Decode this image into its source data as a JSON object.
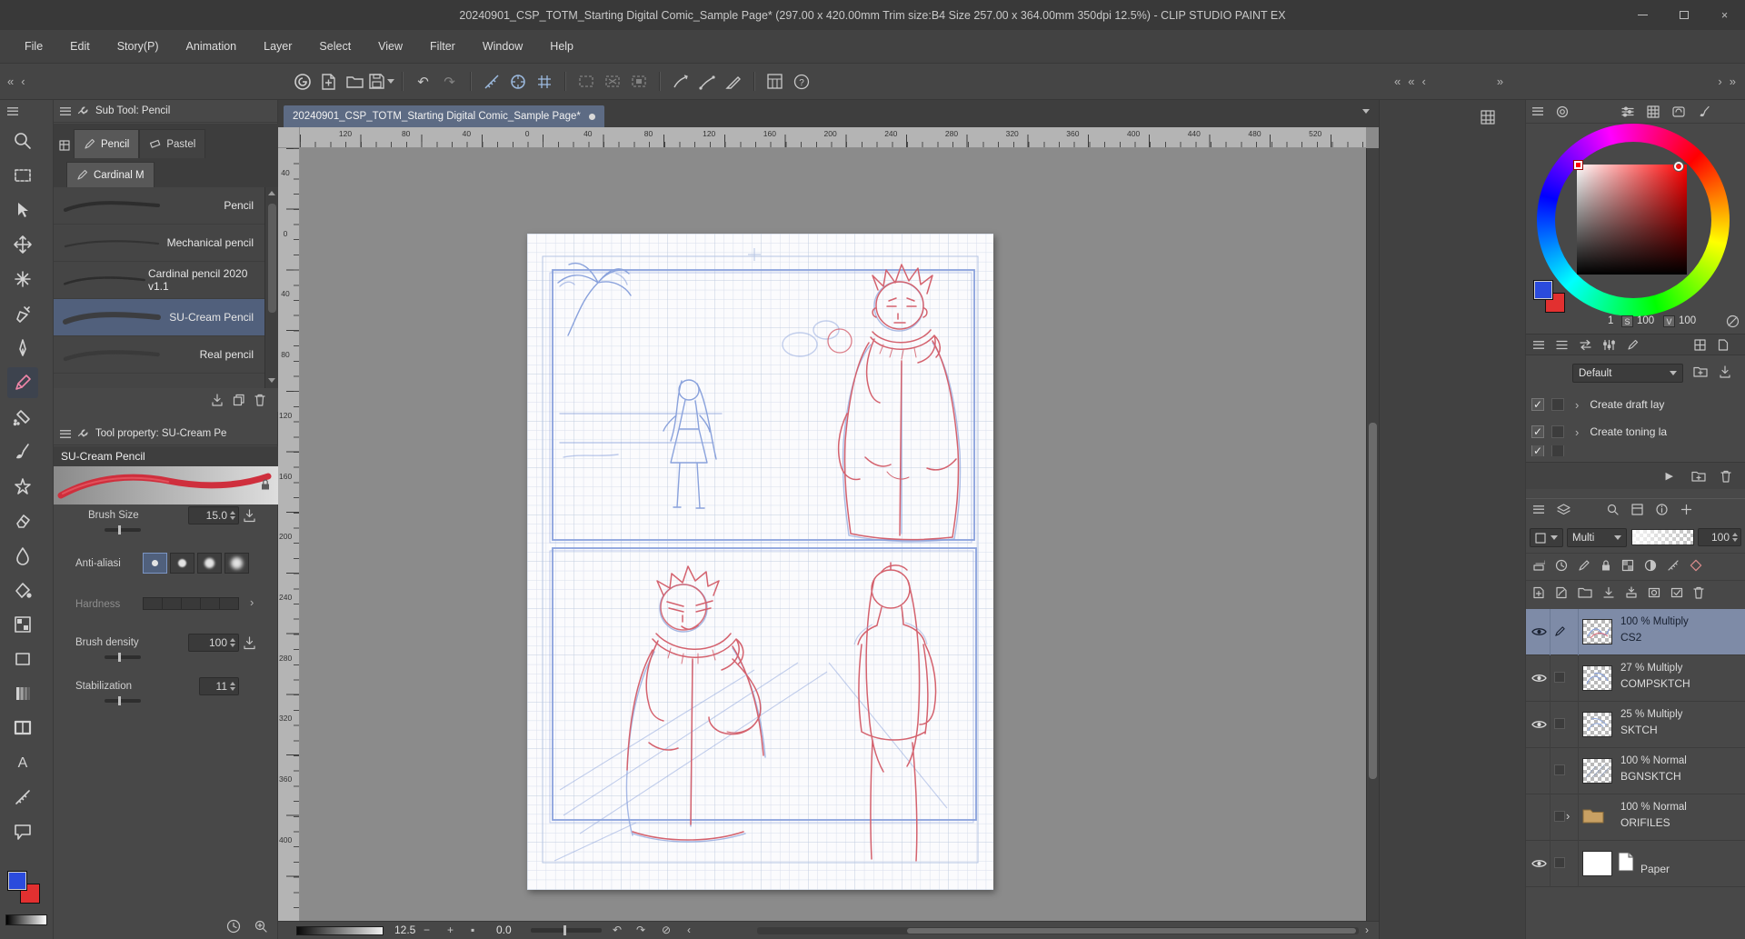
{
  "window": {
    "title": "20240901_CSP_TOTM_Starting Digital Comic_Sample Page* (297.00 x 420.00mm Trim size:B4 Size 257.00 x 364.00mm 350dpi 12.5%)  - CLIP STUDIO PAINT EX",
    "close": "×"
  },
  "menubar": {
    "items": [
      "File",
      "Edit",
      "Story(P)",
      "Animation",
      "Layer",
      "Select",
      "View",
      "Filter",
      "Window",
      "Help"
    ]
  },
  "glyphs": {
    "back2": "«",
    "back1": "‹",
    "fwd2": "»",
    "fwd1": "›",
    "undo": "↶",
    "redo": "↷",
    "reset": "⊘",
    "fit": "▪",
    "minus": "−",
    "plus": "+",
    "help": "?",
    "check": "✓",
    "text_tool": "A"
  },
  "subtool": {
    "header": "Sub Tool: Pencil",
    "tab1": "Pencil",
    "tab2": "Pastel",
    "group_tab": "Cardinal M",
    "brushes": [
      {
        "name": "Pencil"
      },
      {
        "name": "Mechanical pencil"
      },
      {
        "name": "Cardinal pencil 2020 v1.1"
      },
      {
        "name": "SU-Cream Pencil"
      },
      {
        "name": "Real pencil"
      }
    ]
  },
  "toolprop": {
    "header": "Tool property: SU-Cream Pe",
    "brush_name": "SU-Cream Pencil",
    "brush_size_label": "Brush Size",
    "brush_size": "15.0",
    "antialias_label": "Anti-aliasi",
    "hardness_label": "Hardness",
    "density_label": "Brush density",
    "density": "100",
    "stabilization_label": "Stabilization",
    "stabilization": "11"
  },
  "canvas": {
    "tab": "20240901_CSP_TOTM_Starting Digital Comic_Sample Page*",
    "ruler_top": [
      "120",
      "80",
      "40",
      "0",
      "40",
      "80",
      "120",
      "160",
      "200",
      "240",
      "280",
      "320",
      "360",
      "400",
      "440",
      "480",
      "520"
    ],
    "ruler_left": [
      "40",
      "0",
      "40",
      "80",
      "120",
      "160",
      "200",
      "240",
      "280",
      "320",
      "360",
      "400"
    ]
  },
  "statusbar": {
    "zoom": "12.5",
    "rotation": "0.0"
  },
  "color": {
    "hue": "1",
    "s_label": "S",
    "s": "100",
    "v_label": "V",
    "v": "100",
    "main": "#2b4bdc",
    "sub": "#e23030"
  },
  "autoaction": {
    "set_name": "Default",
    "item1": "Create draft lay",
    "item2": "Create toning la"
  },
  "layers": {
    "blend": "Multi",
    "opacity": "100",
    "rows": [
      {
        "meta": "100 % Multiply",
        "name": "CS2"
      },
      {
        "meta": "27 % Multiply",
        "name": "COMPSKTCH"
      },
      {
        "meta": "25 % Multiply",
        "name": "SKTCH"
      },
      {
        "meta": "100 % Normal",
        "name": "BGNSKTCH"
      },
      {
        "meta": "100 % Normal",
        "name": "ORIFILES"
      },
      {
        "meta": "",
        "name": "Paper"
      }
    ]
  },
  "colors": {
    "selection": "#7e8ba7",
    "accent_blue": "#2b4bdc",
    "accent_red": "#e23030",
    "sketch_blue": "#8aa2dc",
    "sketch_red": "#d4626e"
  }
}
